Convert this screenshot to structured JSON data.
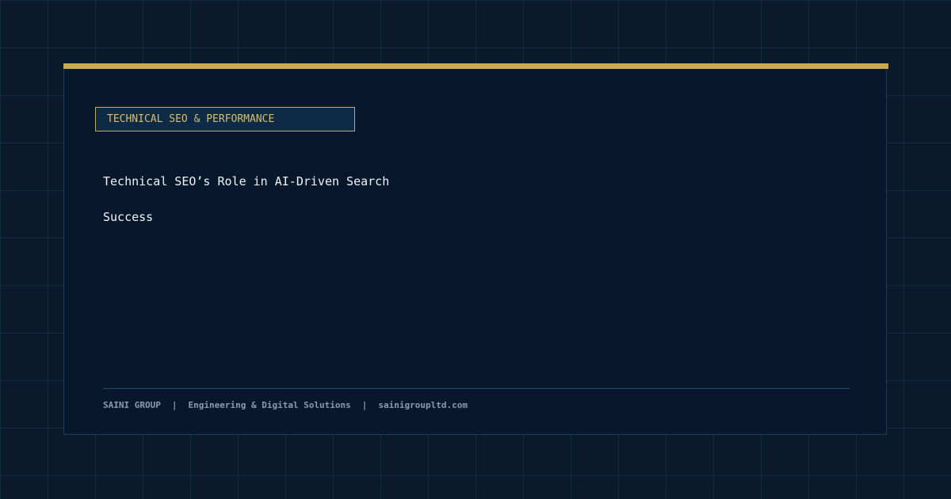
{
  "badge": {
    "label": "TECHNICAL SEO & PERFORMANCE"
  },
  "title": {
    "line1": "Technical SEO’s Role in AI-Driven Search",
    "line2": "Success"
  },
  "footer": {
    "company": "SAINI GROUP",
    "separator": "|",
    "tagline": "Engineering & Digital Solutions",
    "website": "sainigroupltd.com"
  },
  "colors": {
    "background": "#0a1a2c",
    "card": "#07182c",
    "accent_gold": "#c9a94b",
    "title_text": "#f2f4f7",
    "footer_text": "#8a9cb5"
  }
}
